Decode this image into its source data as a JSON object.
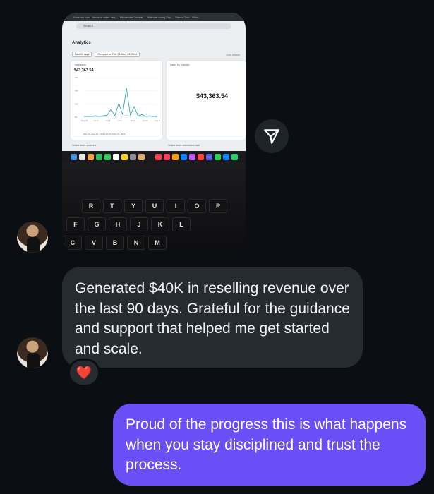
{
  "photo": {
    "browser_tabs": [
      "Amazon.com",
      "Amazon seller cen...",
      "Wholesale Central...",
      "Walmart.com | Sav...",
      "Sam's Club - Who..."
    ],
    "search_placeholder": "Search",
    "page_title": "Analytics",
    "filter_period": "Last 90 days",
    "filter_compare": "Compare to: Feb 24–May 23, 2024",
    "auto_refresh": "Auto refresh",
    "total_sales_label": "Total sales",
    "total_sales_value": "$43,363.54",
    "chart_legend": "May 24–Aug 21, 2024     Feb 24–May 23, 2024",
    "sales_by_channel_label": "Sales by channel",
    "sales_by_channel_value": "$43,363.54",
    "online_sessions_label": "Online store sessions",
    "conversion_label": "Online store conversion rate",
    "chart_data": {
      "type": "line",
      "x_tick_labels": [
        "May 24",
        "Jun 6",
        "Jun 19",
        "Jul 2",
        "Jul 15",
        "Jul 28",
        "Aug 10"
      ],
      "y_tick_labels": [
        "$6K",
        "$4K",
        "$2K",
        "$0"
      ],
      "series": [
        {
          "values": [
            0.1,
            0.1,
            0.1,
            0.2,
            0.1,
            0.2,
            0.3,
            1.2,
            0.2,
            2.1,
            0.4,
            4.4,
            0.3,
            1.6,
            0.2,
            0.4,
            0.1,
            0.2,
            0.1,
            0.1
          ]
        },
        {
          "values": [
            0.1,
            0.1,
            0.1,
            0.1,
            0.1,
            0.1,
            0.1,
            0.2,
            0.1,
            0.2,
            0.1,
            0.3,
            0.1,
            0.2,
            0.1,
            0.1,
            0.1,
            0.1,
            0.1,
            0.1
          ]
        }
      ],
      "colors": [
        "#3aa6b9",
        "#b9d9e6"
      ]
    },
    "keyboard_rows": [
      [
        "R",
        "T",
        "Y",
        "U",
        "I",
        "O",
        "P"
      ],
      [
        "F",
        "G",
        "H",
        "J",
        "K",
        "L"
      ],
      [
        "C",
        "V",
        "B",
        "N",
        "M"
      ]
    ]
  },
  "messages": {
    "received_text": "Generated $40K in reselling revenue over the last 90 days. Grateful for the guidance and support that helped me get started and scale.",
    "reaction": "❤️",
    "sent_text": "Proud of the progress this is what happens when you stay disciplined and trust the process."
  },
  "colors": {
    "background": "#0b0f14",
    "received_bubble": "#262a31",
    "sent_bubble": "#6a4ff6"
  },
  "icons": {
    "share": "paper-plane-icon"
  }
}
